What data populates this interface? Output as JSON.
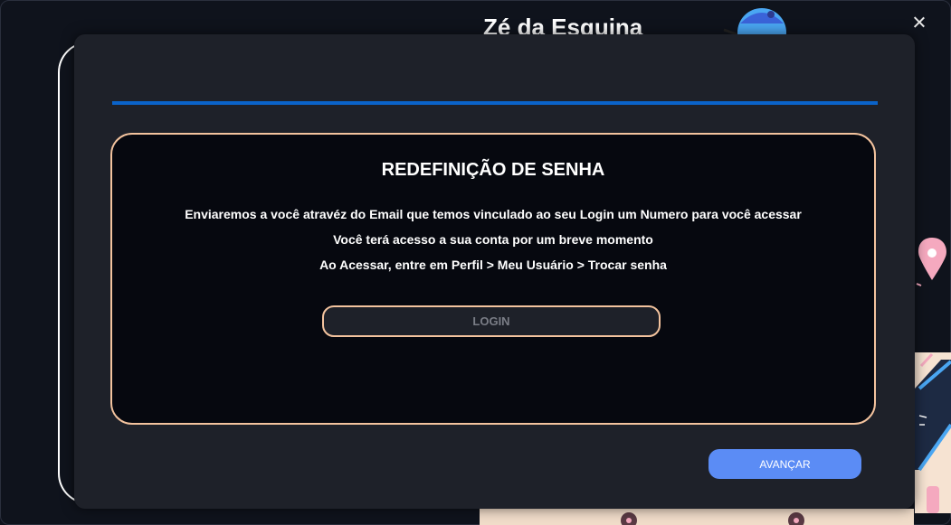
{
  "window": {
    "app_title": "Zé da Esquina",
    "close_icon": "close-icon"
  },
  "modal": {
    "progress_percent": 100,
    "title": "REDEFINIÇÃO DE SENHA",
    "lines": [
      "Enviaremos a você atravéz do Email que temos vinculado ao seu Login um Numero para você acessar",
      "Você terá acesso a sua conta por um breve momento",
      "Ao Acessar, entre em Perfil > Meu Usuário > Trocar senha"
    ],
    "login_placeholder": "LOGIN",
    "login_value": "",
    "next_label": "AVANÇAR"
  },
  "colors": {
    "accent_blue": "#0a63c9",
    "button_blue": "#5b8cf5",
    "card_border": "#f3c39e",
    "modal_bg": "#1e2129",
    "card_bg": "#06080f",
    "page_bg": "#0f131c"
  }
}
